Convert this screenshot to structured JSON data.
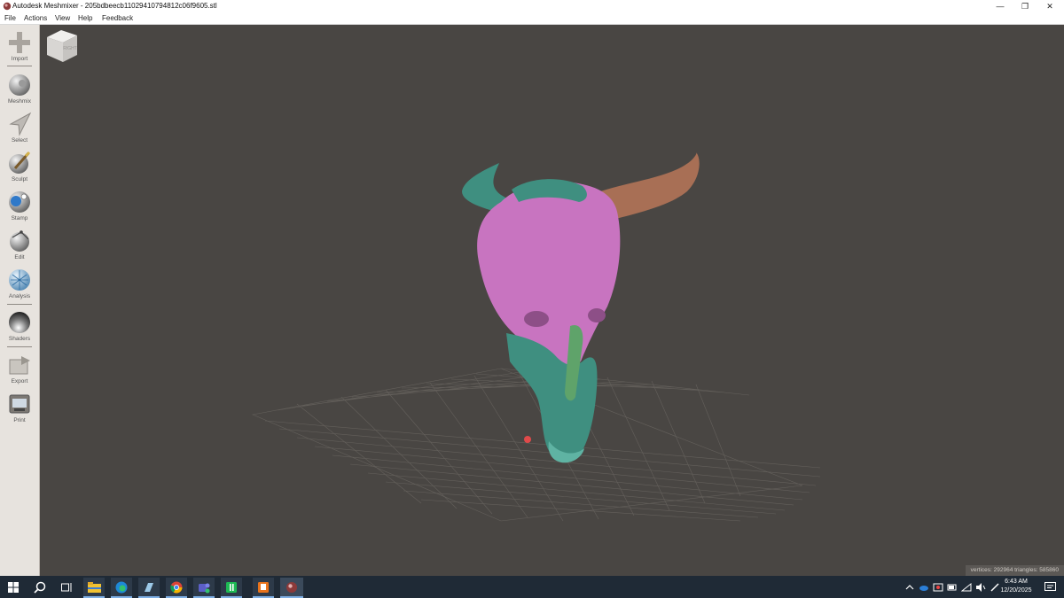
{
  "window": {
    "title": "Autodesk Meshmixer - 205bdbeecb11029410794812c06f9605.stl",
    "controls": [
      "minimize",
      "restore",
      "close"
    ]
  },
  "menu": {
    "items": [
      "File",
      "Actions",
      "View",
      "Help",
      "Feedback"
    ]
  },
  "toolbar": {
    "tools": [
      {
        "label": "Import",
        "icon": "plus-icon"
      },
      {
        "label": "Meshmix",
        "icon": "meshmix-ball-icon"
      },
      {
        "label": "Select",
        "icon": "arrow-select-icon"
      },
      {
        "label": "Sculpt",
        "icon": "brush-sphere-icon"
      },
      {
        "label": "Stamp",
        "icon": "stamp-sphere-icon"
      },
      {
        "label": "Edit",
        "icon": "edit-sphere-icon"
      },
      {
        "label": "Analysis",
        "icon": "analysis-sphere-icon"
      },
      {
        "label": "Shaders",
        "icon": "shader-sphere-icon"
      },
      {
        "label": "Export",
        "icon": "export-folder-icon"
      },
      {
        "label": "Print",
        "icon": "printer-icon"
      }
    ]
  },
  "viewport": {
    "navcube_face": "RIGHT",
    "stats": "vertices: 292964 triangles: 585860",
    "model_colors": {
      "pink": "#c874c0",
      "teal": "#3f8f80",
      "horn": "#a86f55",
      "background": "#494643",
      "grid": "#6b6762"
    }
  },
  "taskbar": {
    "apps": [
      "start-icon",
      "search-icon",
      "task-view-icon",
      "file-explorer-icon",
      "edge-icon",
      "app-icon-blue",
      "chrome-icon",
      "teams-icon",
      "green-app-icon",
      "orange-app-icon",
      "meshmixer-icon"
    ],
    "time": "6:43 AM",
    "date": "12/20/2025"
  }
}
